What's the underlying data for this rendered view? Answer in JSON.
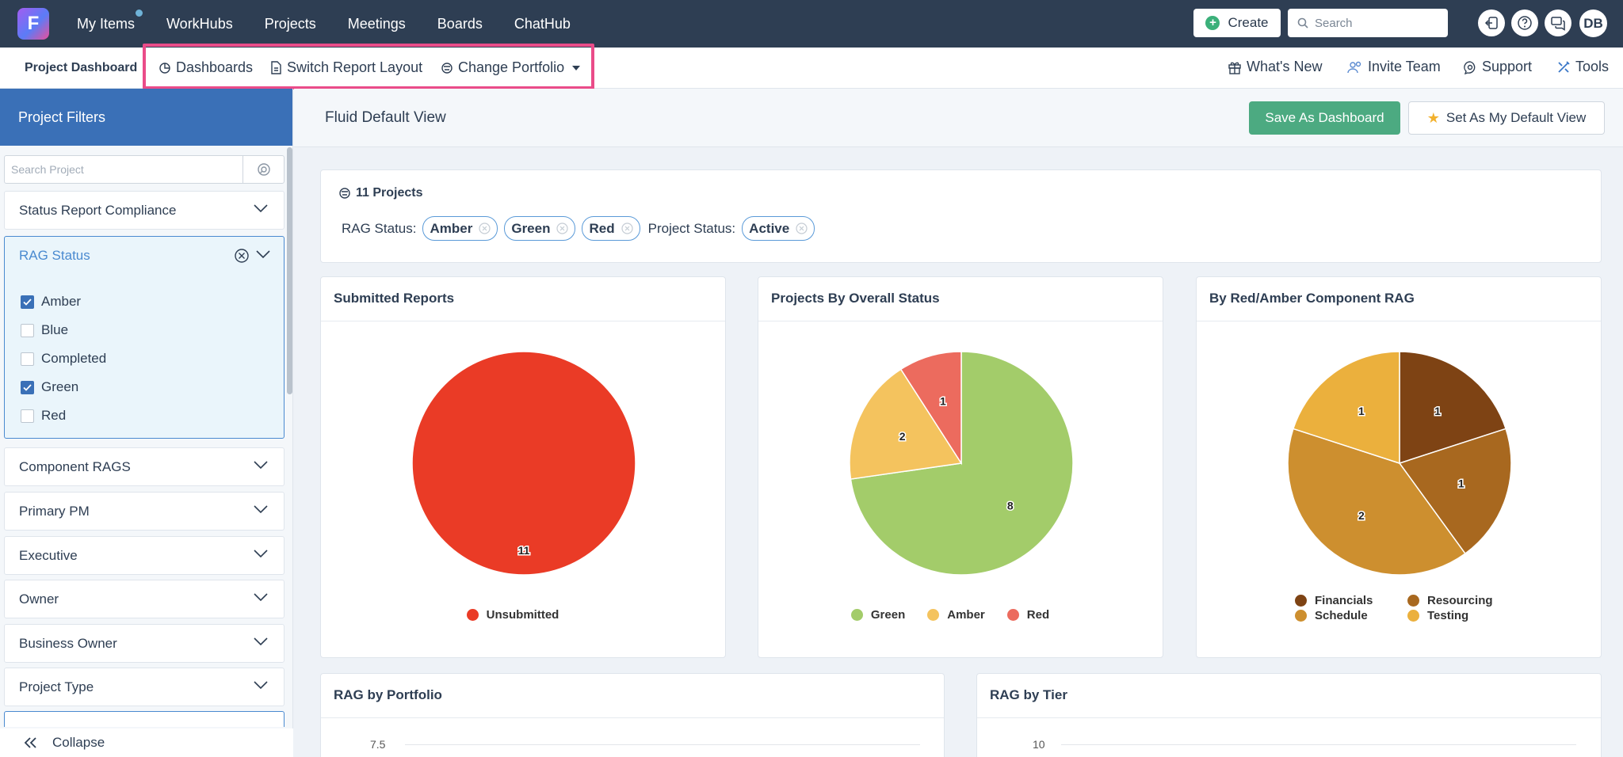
{
  "topnav": {
    "logo_letter": "F",
    "items": [
      "My Items",
      "WorkHubs",
      "Projects",
      "Meetings",
      "Boards",
      "ChatHub"
    ],
    "create_label": "Create",
    "search_placeholder": "Search",
    "avatar_initials": "DB"
  },
  "subnav": {
    "title": "Project Dashboard",
    "dashboards": "Dashboards",
    "switch_layout": "Switch Report Layout",
    "change_portfolio": "Change Portfolio",
    "whats_new": "What's New",
    "invite_team": "Invite Team",
    "support": "Support",
    "tools": "Tools"
  },
  "sidebar": {
    "header": "Project Filters",
    "search_placeholder": "Search Project",
    "status_report_compliance": "Status Report Compliance",
    "rag_status": {
      "title": "RAG Status",
      "options": [
        {
          "label": "Amber",
          "checked": true
        },
        {
          "label": "Blue",
          "checked": false
        },
        {
          "label": "Completed",
          "checked": false
        },
        {
          "label": "Green",
          "checked": true
        },
        {
          "label": "Red",
          "checked": false
        }
      ]
    },
    "filters": [
      "Component RAGS",
      "Primary PM",
      "Executive",
      "Owner",
      "Business Owner",
      "Project Type"
    ],
    "collapse": "Collapse"
  },
  "main": {
    "view_title": "Fluid Default View",
    "save_dashboard": "Save As Dashboard",
    "set_default": "Set As My Default View",
    "summary": {
      "count": "11 Projects",
      "rag_label": "RAG Status:",
      "rag_chips": [
        "Amber",
        "Green",
        "Red"
      ],
      "project_status_label": "Project Status:",
      "project_status_chips": [
        "Active"
      ]
    },
    "cards": {
      "submitted": "Submitted Reports",
      "overall": "Projects By Overall Status",
      "component": "By Red/Amber Component RAG",
      "portfolio": "RAG by Portfolio",
      "tier": "RAG by Tier"
    }
  },
  "chart_data": [
    {
      "type": "pie",
      "title": "Submitted Reports",
      "categories": [
        "Unsubmitted"
      ],
      "values": [
        11
      ],
      "colors": [
        "#ea3b26"
      ],
      "legend": "bottom"
    },
    {
      "type": "pie",
      "title": "Projects By Overall Status",
      "categories": [
        "Green",
        "Amber",
        "Red"
      ],
      "values": [
        8,
        2,
        1
      ],
      "colors": [
        "#a3cc6a",
        "#f4c35e",
        "#ec6b5e"
      ],
      "legend": "bottom"
    },
    {
      "type": "pie",
      "title": "By Red/Amber Component RAG",
      "categories": [
        "Financials",
        "Resourcing",
        "Schedule",
        "Testing"
      ],
      "values": [
        1,
        1,
        2,
        1
      ],
      "colors": [
        "#7e4314",
        "#a8681f",
        "#cd8f2f",
        "#ebb03d"
      ],
      "legend": "bottom"
    },
    {
      "type": "bar",
      "title": "RAG by Portfolio",
      "tick_labels": [
        "7.5"
      ]
    },
    {
      "type": "bar",
      "title": "RAG by Tier",
      "tick_labels": [
        "10"
      ]
    }
  ]
}
